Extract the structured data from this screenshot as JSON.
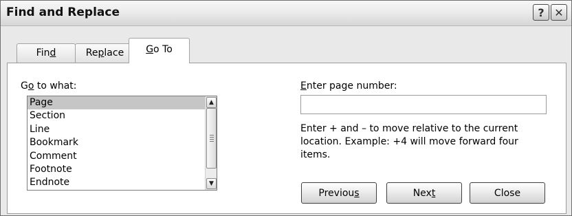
{
  "window": {
    "title": "Find and Replace",
    "help_glyph": "?",
    "close_glyph": "✕"
  },
  "tabs": [
    {
      "label_pre": "Fin",
      "mnemonic": "d",
      "label_post": "",
      "active": false
    },
    {
      "label_pre": "Re",
      "mnemonic": "p",
      "label_post": "lace",
      "active": false
    },
    {
      "label_pre": "",
      "mnemonic": "G",
      "label_post": "o To",
      "active": true
    }
  ],
  "goto": {
    "label_pre": "G",
    "mnemonic": "o",
    "label_post": " to what:",
    "items": [
      "Page",
      "Section",
      "Line",
      "Bookmark",
      "Comment",
      "Footnote",
      "Endnote"
    ],
    "selected": "Page"
  },
  "page_number": {
    "label_mnemonic": "E",
    "label_post": "nter page number:",
    "value": "",
    "placeholder": ""
  },
  "hint": "Enter + and – to move relative to the current location. Example: +4 will move forward four items.",
  "buttons": {
    "previous": {
      "pre": "Previou",
      "mnemonic": "s",
      "post": ""
    },
    "next": {
      "pre": "Nex",
      "mnemonic": "t",
      "post": ""
    },
    "close": {
      "label": "Close"
    }
  },
  "colors": {
    "title_bar": "#e6e6e6",
    "dialog_background": "#e9e9e9",
    "selection": "#c6c6c6"
  }
}
